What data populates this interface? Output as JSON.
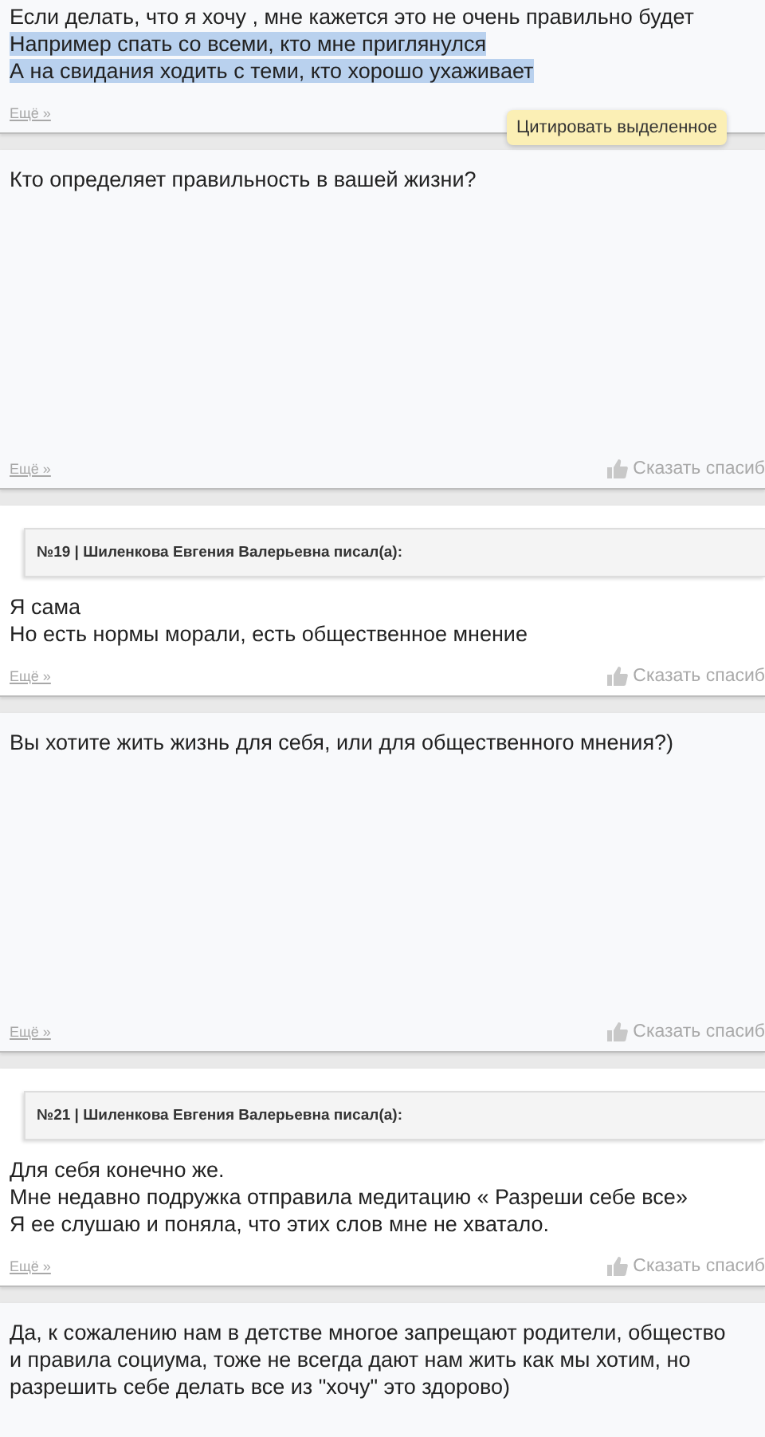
{
  "posts": [
    {
      "kind": "plain",
      "lines": [
        {
          "text": "Если делать, что я хочу , мне кажется это не очень правильно будет",
          "highlighted": false
        },
        {
          "text": "Например спать со всеми, кто мне приглянулся",
          "highlighted": true
        },
        {
          "text": "А на свидания ходить с теми, кто хорошо ухаживает",
          "highlighted": true
        }
      ],
      "more": "Ещё »",
      "tooltip": "Цитировать выделенное"
    },
    {
      "kind": "plain",
      "lines": [
        {
          "text": "Кто определяет правильность в вашей жизни?",
          "highlighted": false
        }
      ],
      "more": "Ещё »",
      "thanks": "Сказать спасиб"
    },
    {
      "kind": "reply",
      "quote": "№19 | Шиленкова Евгения Валерьевна писал(а):",
      "lines": [
        {
          "text": "Я сама",
          "highlighted": false
        },
        {
          "text": "Но есть нормы морали, есть общественное мнение",
          "highlighted": false
        }
      ],
      "more": "Ещё »",
      "thanks": "Сказать спасиб"
    },
    {
      "kind": "plain",
      "lines": [
        {
          "text": "Вы хотите жить жизнь для себя, или для общественного мнения?)",
          "highlighted": false
        }
      ],
      "more": "Ещё »",
      "thanks": "Сказать спасиб"
    },
    {
      "kind": "reply",
      "quote": "№21 | Шиленкова Евгения Валерьевна писал(а):",
      "lines": [
        {
          "text": "Для себя конечно же.",
          "highlighted": false
        },
        {
          "text": "Мне недавно подружка отправила медитацию « Разреши себе все»",
          "highlighted": false
        },
        {
          "text": "Я ее слушаю и поняла, что этих слов мне не хватало.",
          "highlighted": false
        }
      ],
      "more": "Ещё »",
      "thanks": "Сказать спасиб"
    },
    {
      "kind": "plain",
      "lines": [
        {
          "text": "Да, к сожалению нам в детстве многое запрещают родители, общество и правила социума, тоже не всегда дают нам жить как мы хотим, но разрешить себе делать все из \"хочу\" это здорово)",
          "highlighted": false
        }
      ]
    }
  ]
}
